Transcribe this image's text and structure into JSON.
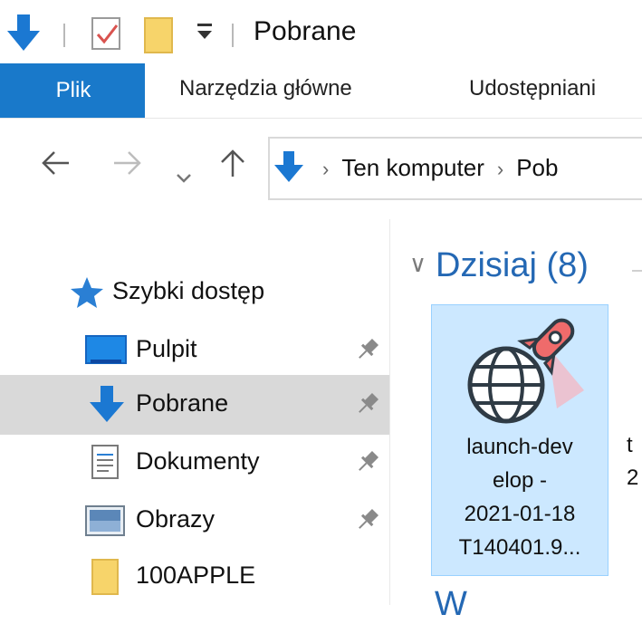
{
  "window": {
    "title": "Pobrane"
  },
  "quick_access_toolbar": {
    "icons": [
      "download-arrow-icon",
      "properties-icon",
      "new-folder-icon",
      "customize-dropdown-icon"
    ]
  },
  "ribbon": {
    "tabs": [
      {
        "label": "Plik",
        "active": true
      },
      {
        "label": "Narzędzia główne"
      },
      {
        "label": "Udostępniani"
      }
    ],
    "accent_color": "#1979ca"
  },
  "navigation": {
    "breadcrumb": [
      "Ten komputer",
      "Pob"
    ]
  },
  "sidebar": {
    "items": [
      {
        "label": "Szybki dostęp",
        "icon": "star-icon",
        "pinned": false
      },
      {
        "label": "Pulpit",
        "icon": "desktop-icon",
        "pinned": true
      },
      {
        "label": "Pobrane",
        "icon": "download-arrow-icon",
        "pinned": true,
        "selected": true
      },
      {
        "label": "Dokumenty",
        "icon": "document-icon",
        "pinned": true
      },
      {
        "label": "Obrazy",
        "icon": "pictures-icon",
        "pinned": true
      },
      {
        "label": "100APPLE",
        "icon": "folder-icon",
        "pinned": false
      }
    ]
  },
  "content": {
    "group_header": "Dzisiaj (8)",
    "files": [
      {
        "name_lines": [
          "launch-dev",
          "elop -",
          "2021-01-18",
          "T140401.9..."
        ],
        "icon": "globe-rocket-icon",
        "selected": true
      },
      {
        "name_lines": [
          "t",
          "2"
        ]
      }
    ],
    "next_group_header": "W"
  }
}
